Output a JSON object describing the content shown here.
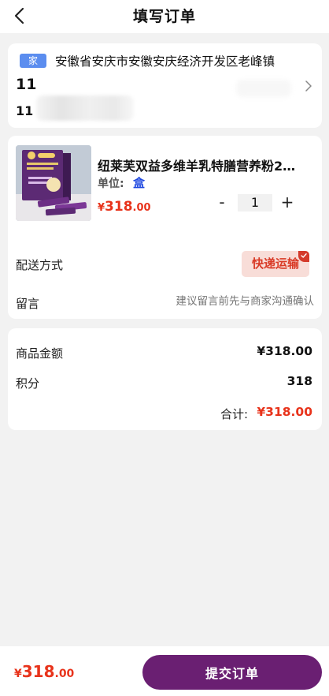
{
  "nav": {
    "title": "填写订单"
  },
  "address": {
    "tag": "家",
    "text": "安徽省安庆市安徽安庆经济开发区老峰镇",
    "name": "11",
    "phone_prefix": "11"
  },
  "product": {
    "name": "纽莱芙双益多维羊乳特膳营养粉2…",
    "unit_label": "单位:",
    "unit_value": "盒",
    "price_currency": "¥",
    "price_int": "318",
    "price_dec": ".00",
    "quantity": "1",
    "minus": "-",
    "plus": "+"
  },
  "shipping": {
    "label": "配送方式",
    "method": "快递运输"
  },
  "message": {
    "label": "留言",
    "placeholder": "建议留言前先与商家沟通确认"
  },
  "totals": {
    "goods_label": "商品金额",
    "goods_value": "¥318.00",
    "points_label": "积分",
    "points_value": "318",
    "sum_label": "合计:",
    "sum_value": "¥318.00"
  },
  "footer": {
    "price_currency": "¥",
    "price_int": "318",
    "price_dec": ".00",
    "submit_label": "提交订单"
  },
  "colors": {
    "accent": "#6a1f72",
    "price": "#e8331b",
    "tag": "#5b8def",
    "unit": "#1f48e0"
  }
}
